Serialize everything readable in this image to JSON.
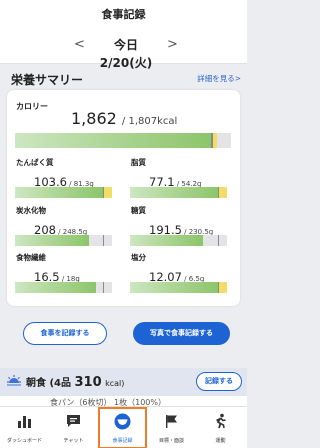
{
  "header": {
    "title": "食事記録",
    "prev_arrow": "<",
    "next_arrow": ">",
    "date": "今日2/20(火)"
  },
  "nutrition": {
    "section_title": "栄養サマリー",
    "detail_link": "詳細を見る>",
    "calorie": {
      "label": "カロリー",
      "value": "1,862",
      "target": "1,807kcal",
      "progress": 1.03
    },
    "items": [
      {
        "label": "たんぱく質",
        "value": "103.6",
        "target": "81.3g",
        "progress": 1.27
      },
      {
        "label": "脂質",
        "value": "77.1",
        "target": "54.2g",
        "progress": 1.42
      },
      {
        "label": "炭水化物",
        "value": "208",
        "target": "248.5g",
        "progress": 0.84
      },
      {
        "label": "糖質",
        "value": "191.5",
        "target": "230.5g",
        "progress": 0.83
      },
      {
        "label": "食物繊維",
        "value": "16.5",
        "target": "18g",
        "progress": 0.92
      },
      {
        "label": "塩分",
        "value": "12.07",
        "target": "6.5g",
        "progress": 1.86
      }
    ]
  },
  "actions": {
    "record": "食事を記録する",
    "photo_record": "写真で食事記録する"
  },
  "meal": {
    "name": "朝食",
    "count": "(4品",
    "kcal_value": "310",
    "kcal_unit": "kcal)",
    "record_button": "記録する",
    "peek_item": "食パン（6枚切）   1枚（100%）"
  },
  "tabs": [
    {
      "label": "ダッシュボード",
      "icon": "bar-chart-icon"
    },
    {
      "label": "チャット",
      "icon": "chat-icon"
    },
    {
      "label": "食事記録",
      "icon": "meal-bowl-icon"
    },
    {
      "label": "目標・面談",
      "icon": "flag-icon"
    },
    {
      "label": "運動",
      "icon": "running-icon"
    }
  ],
  "colors": {
    "accent": "#1e63d4",
    "bar_fill": "#8cc66b",
    "bar_excess": "#f2de66",
    "active_tab_outline": "#f07c2a"
  }
}
